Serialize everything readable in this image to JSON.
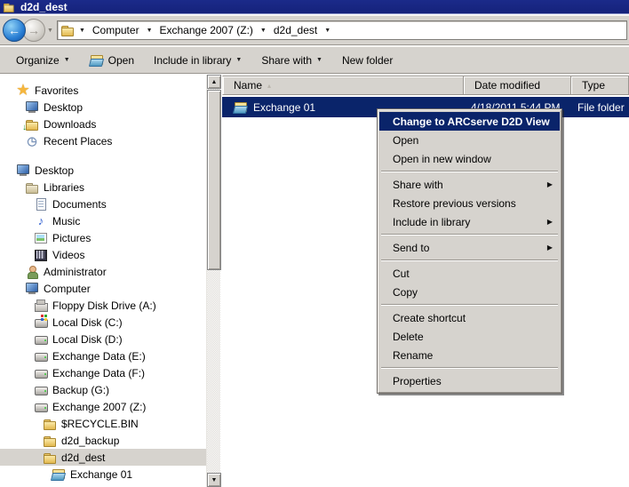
{
  "colors": {
    "titlebar": "#15227a",
    "selection": "#0a246a",
    "chrome": "#d6d3ce",
    "tree-select": "#d6d3ce"
  },
  "window": {
    "title": "d2d_dest"
  },
  "icon_glyphs": {
    "star": "★",
    "music": "♪",
    "folder-download": "↓",
    "recent": "◷"
  },
  "nav": {
    "back_glyph": "←",
    "forward_glyph": "→",
    "history_chevron": "▼"
  },
  "address_bar": {
    "icon": "folder",
    "crumb_sep": "▼",
    "crumbs": [
      "Computer",
      "Exchange 2007 (Z:)",
      "d2d_dest"
    ]
  },
  "toolbar": {
    "items": [
      {
        "label": "Organize",
        "dropdown": true
      },
      {
        "label": "Open",
        "icon": "folder-open"
      },
      {
        "label": "Include in library",
        "dropdown": true
      },
      {
        "label": "Share with",
        "dropdown": true
      },
      {
        "label": "New folder"
      }
    ],
    "dropdown_glyph": "▼"
  },
  "sidebar": {
    "items": [
      {
        "label": "Favorites",
        "icon": "star",
        "indent": 0
      },
      {
        "label": "Desktop",
        "icon": "monitor",
        "indent": 1
      },
      {
        "label": "Downloads",
        "icon": "folder-download",
        "indent": 1
      },
      {
        "label": "Recent Places",
        "icon": "recent",
        "indent": 1
      },
      {
        "label": "Desktop",
        "icon": "monitor",
        "indent": 0,
        "gap_before": true
      },
      {
        "label": "Libraries",
        "icon": "lib",
        "indent": 1
      },
      {
        "label": "Documents",
        "icon": "doc",
        "indent": 2
      },
      {
        "label": "Music",
        "icon": "music",
        "indent": 2
      },
      {
        "label": "Pictures",
        "icon": "pic",
        "indent": 2
      },
      {
        "label": "Videos",
        "icon": "video",
        "indent": 2
      },
      {
        "label": "Administrator",
        "icon": "user",
        "indent": 1
      },
      {
        "label": "Computer",
        "icon": "computer",
        "indent": 1
      },
      {
        "label": "Floppy Disk Drive (A:)",
        "icon": "floppy",
        "indent": 2
      },
      {
        "label": "Local Disk (C:)",
        "icon": "disk-win",
        "indent": 2
      },
      {
        "label": "Local Disk (D:)",
        "icon": "disk",
        "indent": 2
      },
      {
        "label": "Exchange Data (E:)",
        "icon": "disk",
        "indent": 2
      },
      {
        "label": "Exchange Data (F:)",
        "icon": "disk",
        "indent": 2
      },
      {
        "label": "Backup (G:)",
        "icon": "disk",
        "indent": 2
      },
      {
        "label": "Exchange 2007 (Z:)",
        "icon": "disk",
        "indent": 2
      },
      {
        "label": "$RECYCLE.BIN",
        "icon": "folder",
        "indent": 3
      },
      {
        "label": "d2d_backup",
        "icon": "folder",
        "indent": 3
      },
      {
        "label": "d2d_dest",
        "icon": "folder",
        "indent": 3,
        "selected": true
      },
      {
        "label": "Exchange 01",
        "icon": "folder-open",
        "indent": 4
      }
    ]
  },
  "scrollbar": {
    "up_glyph": "▲",
    "down_glyph": "▼"
  },
  "file_list": {
    "columns": [
      {
        "label": "Name",
        "sort": "asc",
        "sort_glyph": "▴"
      },
      {
        "label": "Date modified"
      },
      {
        "label": "Type"
      }
    ],
    "rows": [
      {
        "name": "Exchange 01",
        "icon": "folder-open",
        "date_modified": "4/18/2011 5:44 PM",
        "type": "File folder",
        "selected": true
      }
    ]
  },
  "context_menu": {
    "submenu_glyph": "▶",
    "items": [
      {
        "label": "Change to ARCserve D2D View",
        "bold": true,
        "highlighted": true
      },
      {
        "label": "Open"
      },
      {
        "label": "Open in new window"
      },
      {
        "type": "sep"
      },
      {
        "label": "Share with",
        "submenu": true
      },
      {
        "label": "Restore previous versions"
      },
      {
        "label": "Include in library",
        "submenu": true
      },
      {
        "type": "sep"
      },
      {
        "label": "Send to",
        "submenu": true
      },
      {
        "type": "sep"
      },
      {
        "label": "Cut"
      },
      {
        "label": "Copy"
      },
      {
        "type": "sep"
      },
      {
        "label": "Create shortcut"
      },
      {
        "label": "Delete"
      },
      {
        "label": "Rename"
      },
      {
        "type": "sep"
      },
      {
        "label": "Properties"
      }
    ]
  }
}
